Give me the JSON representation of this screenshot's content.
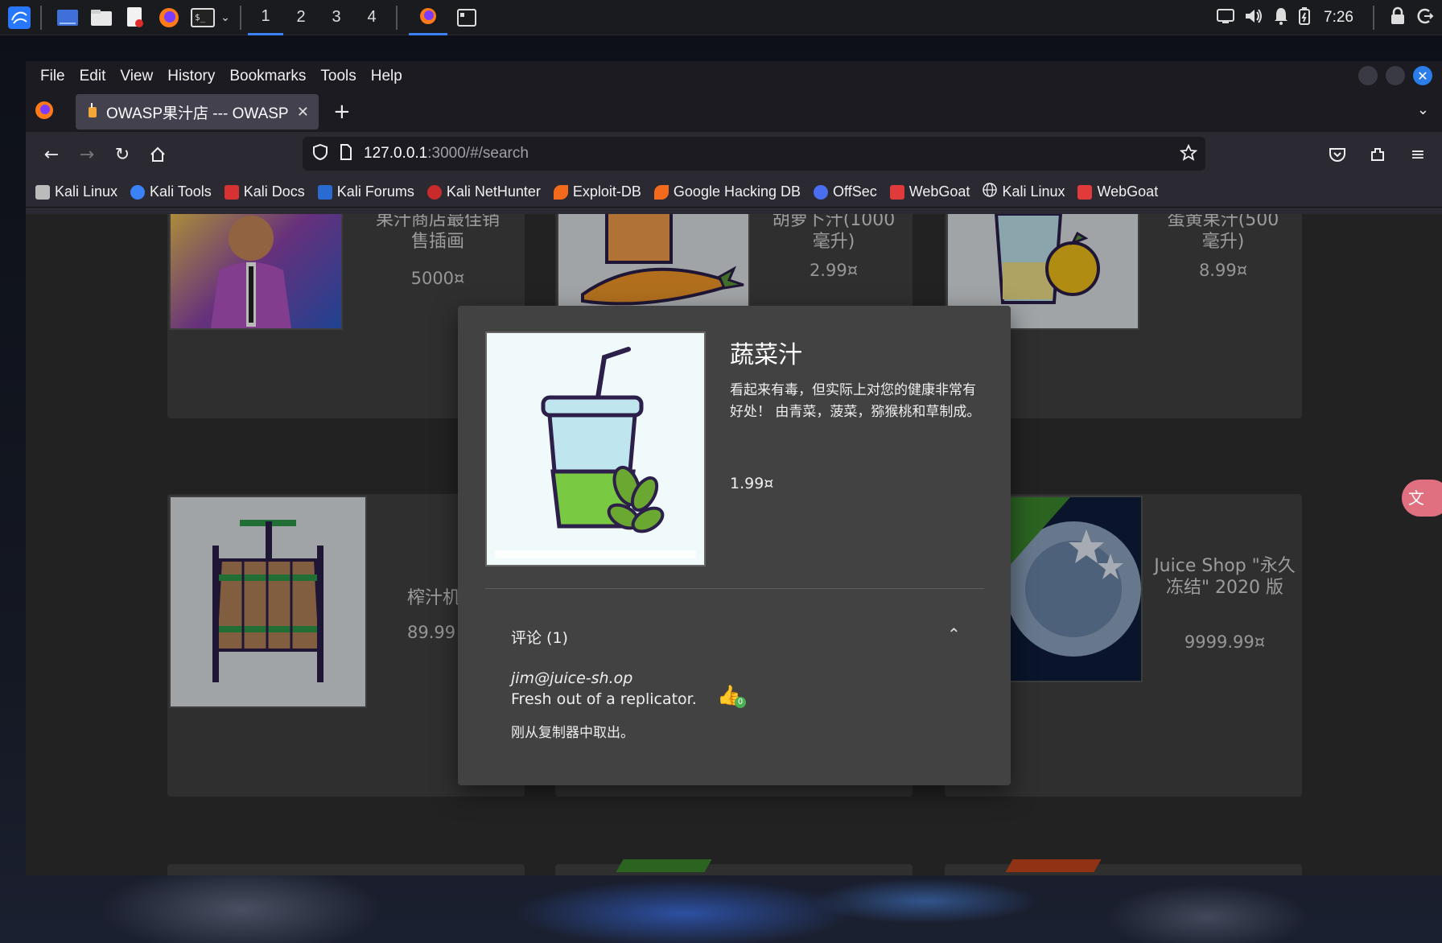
{
  "panel": {
    "workspaces": [
      "1",
      "2",
      "3",
      "4"
    ],
    "clock": "7:26"
  },
  "browser": {
    "menu": [
      "File",
      "Edit",
      "View",
      "History",
      "Bookmarks",
      "Tools",
      "Help"
    ],
    "tab_title": "OWASP果汁店 --- OWASP",
    "url_host": "127.0.0.1",
    "url_path": ":3000/#/search",
    "bookmarks": [
      "Kali Linux",
      "Kali Tools",
      "Kali Docs",
      "Kali Forums",
      "Kali NetHunter",
      "Exploit-DB",
      "Google Hacking DB",
      "OffSec",
      "WebGoat",
      "Kali Linux",
      "WebGoat"
    ]
  },
  "products": [
    {
      "name": "果汁商店最佳销售插画",
      "price": "5000¤"
    },
    {
      "name": "胡萝卜汁(1000毫升)",
      "price": "2.99¤"
    },
    {
      "name": "蛋黄果汁(500毫升)",
      "price": "8.99¤"
    },
    {
      "name": "榨汁机",
      "price": "89.99"
    },
    {
      "name": "Juice Shop \"永久冻结\" 2020 版",
      "price": "9999.99¤"
    }
  ],
  "dialog": {
    "title": "蔬菜汁",
    "description": "看起来有毒，但实际上对您的健康非常有好处！ 由青菜，菠菜，猕猴桃和草制成。",
    "price": "1.99¤",
    "reviews_header": "评论 (1)",
    "review": {
      "author": "jim@juice-sh.op",
      "text": "Fresh out of a replicator.",
      "likes": "0",
      "translation": "刚从复制器中取出。"
    }
  }
}
